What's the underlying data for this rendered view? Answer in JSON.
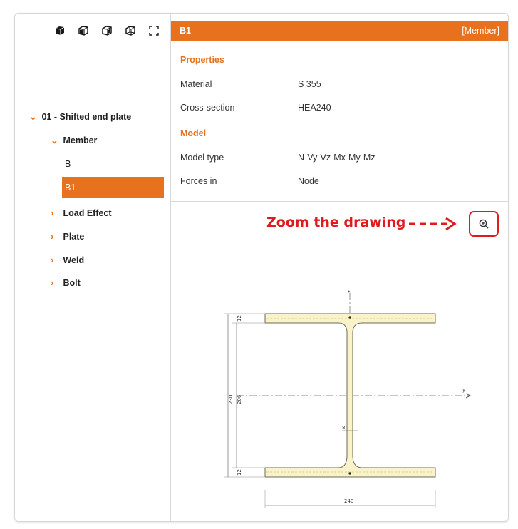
{
  "toolbar": {
    "icons": [
      "view-3d-solid-icon",
      "view-3d-front-icon",
      "view-3d-side-icon",
      "view-3d-wire-icon",
      "fullscreen-icon"
    ]
  },
  "tree": {
    "root": "01 - Shifted end plate",
    "member": "Member",
    "member_children": [
      "B",
      "B1"
    ],
    "selected": "B1",
    "others": [
      "Load Effect",
      "Plate",
      "Weld",
      "Bolt"
    ]
  },
  "header": {
    "title": "B1",
    "type": "[Member]",
    "accent_color": "#e8711e"
  },
  "properties": {
    "section_title": "Properties",
    "material_label": "Material",
    "material_value": "S 355",
    "cross_section_label": "Cross-section",
    "cross_section_value": "HEA240"
  },
  "model": {
    "section_title": "Model",
    "model_type_label": "Model type",
    "model_type_value": "N-Vy-Vz-Mx-My-Mz",
    "forces_in_label": "Forces in",
    "forces_in_value": "Node"
  },
  "annotation": {
    "text": "Zoom the drawing",
    "color": "#e01b1b"
  },
  "drawing": {
    "dims": {
      "height_outer": "230",
      "height_inner": "206",
      "flange_top": "12",
      "flange_bottom": "12",
      "web": "8",
      "width": "240",
      "axis_z": "z",
      "axis_y": "y"
    }
  }
}
